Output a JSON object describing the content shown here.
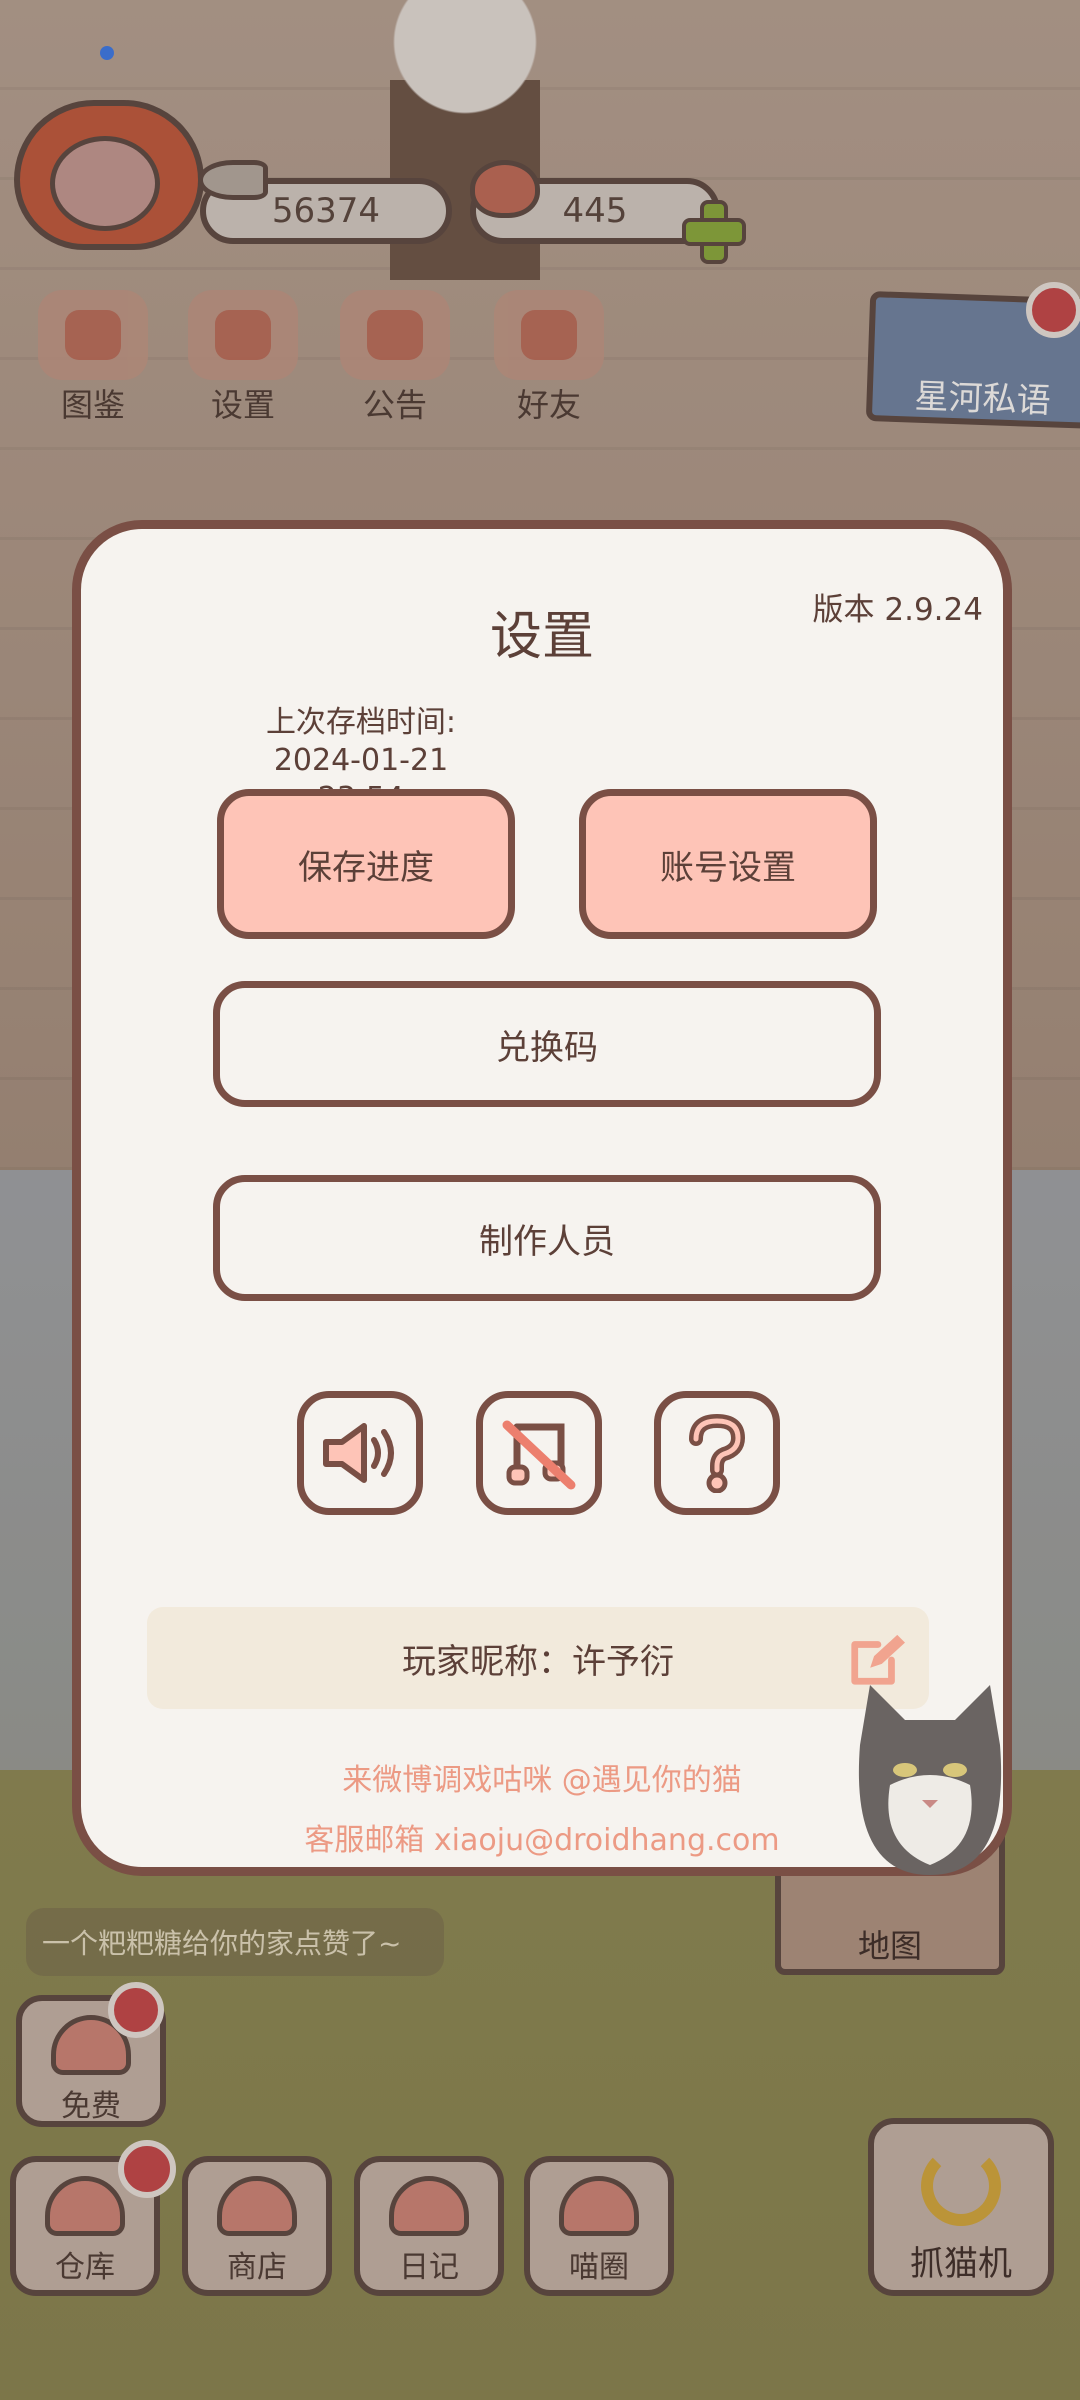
{
  "hud": {
    "fish_count": "56374",
    "heart_count": "445"
  },
  "top_nav": [
    {
      "label": "图鉴",
      "icon": "cat-book-icon"
    },
    {
      "label": "设置",
      "icon": "gear-icon"
    },
    {
      "label": "公告",
      "icon": "gift-icon"
    },
    {
      "label": "好友",
      "icon": "friends-icon"
    }
  ],
  "banner": {
    "label": "星河私语"
  },
  "chat_messages": [
    "一个粑粑糖给你的家点赞了~"
  ],
  "settings": {
    "title": "设置",
    "version": "版本 2.9.24",
    "last_save_label": "上次存档时间:",
    "last_save_time": "2024-01-21 23:54",
    "save_button": "保存进度",
    "account_button": "账号设置",
    "redeem_button": "兑换码",
    "credits_button": "制作人员",
    "nickname_text": "玩家昵称：许予衍",
    "weibo_text": "来微博调戏咕咪 @遇见你的猫",
    "email_text": "客服邮箱 xiaoju@droidhang.com"
  },
  "map_button": {
    "label": "地图"
  },
  "bottom_bar": {
    "free": "免费",
    "warehouse": "仓库",
    "shop": "商店",
    "diary": "日记",
    "circle": "喵圈",
    "claw": "抓猫机"
  },
  "colors": {
    "modal_border": "#7a4f45",
    "pink_button": "#fec4b7",
    "link_text": "#ec9a84",
    "badge_red": "#c8474b"
  }
}
